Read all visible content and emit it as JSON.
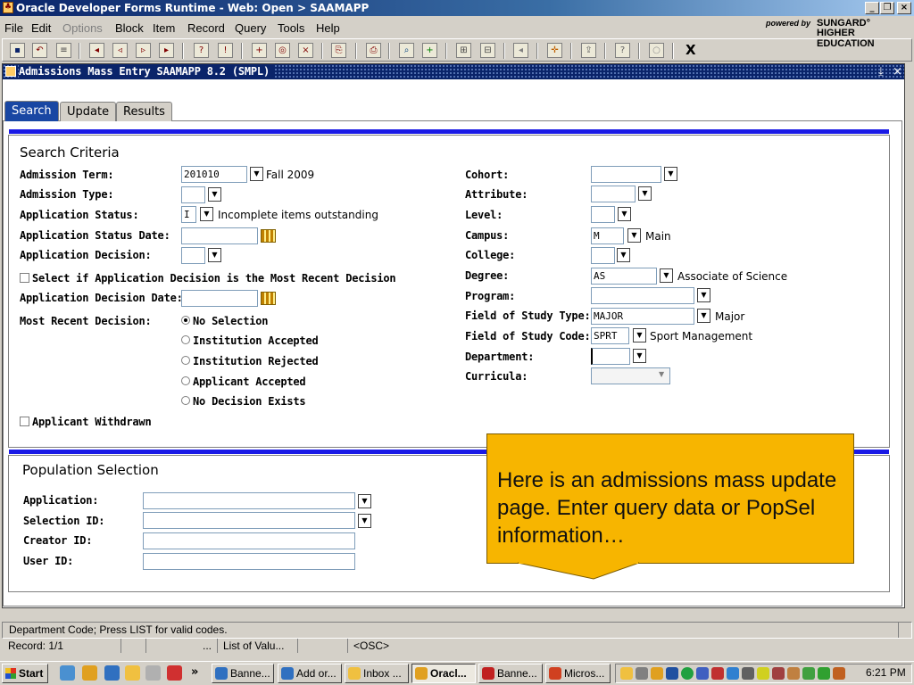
{
  "window": {
    "title": "Oracle Developer Forms Runtime - Web:  Open > SAAMAPP",
    "app_icon": "♣"
  },
  "menu": [
    "File",
    "Edit",
    "Options",
    "Block",
    "Item",
    "Record",
    "Query",
    "Tools",
    "Help"
  ],
  "brand": {
    "powered": "powered by",
    "name1": "SUNGARD°",
    "name2": "HIGHER EDUCATION"
  },
  "toolbar": {
    "exit_label": "X"
  },
  "form": {
    "title": "Admissions Mass Entry  SAAMAPP  8.2  (SMPL)",
    "tabs": [
      "Search",
      "Update",
      "Results"
    ]
  },
  "search": {
    "title": "Search Criteria",
    "admission_term": {
      "label": "Admission Term:",
      "value": "201010",
      "desc": "Fall 2009"
    },
    "admission_type": {
      "label": "Admission Type:",
      "value": ""
    },
    "application_status": {
      "label": "Application Status:",
      "value": "I",
      "desc": "Incomplete items outstanding"
    },
    "application_status_date": {
      "label": "Application Status Date:",
      "value": ""
    },
    "application_decision": {
      "label": "Application Decision:",
      "value": ""
    },
    "most_recent_check": {
      "label": "Select if Application Decision is the Most Recent Decision"
    },
    "application_decision_date": {
      "label": "Application Decision Date:",
      "value": ""
    },
    "most_recent_decision": {
      "label": "Most Recent Decision:",
      "options": [
        "No Selection",
        "Institution Accepted",
        "Institution Rejected",
        "Applicant Accepted",
        "No Decision Exists"
      ]
    },
    "applicant_withdrawn": {
      "label": "Applicant Withdrawn"
    },
    "cohort": {
      "label": "Cohort:",
      "value": ""
    },
    "attribute": {
      "label": "Attribute:",
      "value": ""
    },
    "level": {
      "label": "Level:",
      "value": ""
    },
    "campus": {
      "label": "Campus:",
      "value": "M",
      "desc": "Main"
    },
    "college": {
      "label": "College:",
      "value": ""
    },
    "degree": {
      "label": "Degree:",
      "value": "AS",
      "desc": "Associate of Science"
    },
    "program": {
      "label": "Program:",
      "value": ""
    },
    "field_of_study_type": {
      "label": "Field of Study Type:",
      "value": "MAJOR",
      "desc": "Major"
    },
    "field_of_study_code": {
      "label": "Field of Study Code:",
      "value": "SPRT",
      "desc": "Sport Management"
    },
    "department": {
      "label": "Department:",
      "value": ""
    },
    "curricula": {
      "label": "Curricula:",
      "value": ""
    }
  },
  "population": {
    "title": "Population Selection",
    "application": {
      "label": "Application:",
      "value": ""
    },
    "selection_id": {
      "label": "Selection ID:",
      "value": ""
    },
    "creator_id": {
      "label": "Creator ID:",
      "value": ""
    },
    "user_id": {
      "label": "User ID:",
      "value": ""
    }
  },
  "callout": {
    "text": "Here is an admissions mass update page.  Enter query data or PopSel information…"
  },
  "status": {
    "message": "Department Code; Press LIST for valid codes.",
    "record": "Record: 1/1",
    "cell3": "...",
    "list": "List of Valu...",
    "osc": "<OSC>"
  },
  "taskbar": {
    "start": "Start",
    "tasks": [
      "Banne...",
      "Add or...",
      "Inbox ...",
      "Oracl...",
      "Banne...",
      "Micros..."
    ],
    "active_task": 3,
    "clock": "6:21 PM",
    "more": "»"
  }
}
